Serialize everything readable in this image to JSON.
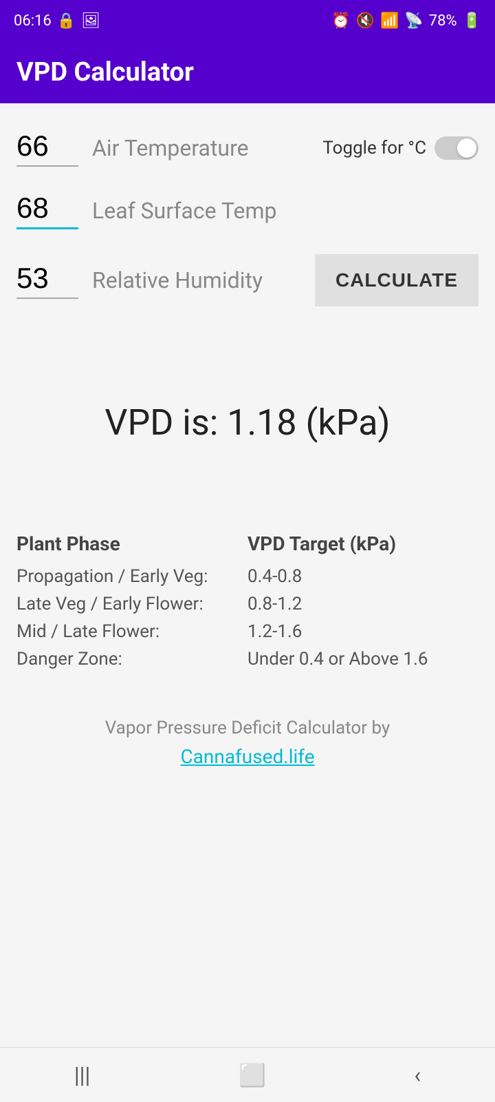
{
  "status_bar": {
    "time": "06:16",
    "battery": "78%"
  },
  "header": {
    "title": "VPD Calculator"
  },
  "fields": {
    "air_temp": {
      "label": "Air Temperature",
      "value": "66",
      "toggle_label": "Toggle for °C"
    },
    "leaf_surface_temp": {
      "label": "Leaf Surface Temp",
      "value": "68"
    },
    "relative_humidity": {
      "label": "Relative Humidity",
      "value": "53"
    }
  },
  "calculate_button": "CALCULATE",
  "vpd_result": "VPD is: 1.18 (kPa)",
  "reference_table": {
    "col1_header": "Plant Phase",
    "col2_header": "VPD Target (kPa)",
    "rows": [
      {
        "phase": "Propagation / Early Veg:",
        "target": "0.4-0.8"
      },
      {
        "phase": "Late Veg / Early Flower:",
        "target": "0.8-1.2"
      },
      {
        "phase": "Mid / Late Flower:",
        "target": "1.2-1.6"
      },
      {
        "phase": "Danger Zone:",
        "target": "Under 0.4 or Above 1.6"
      }
    ]
  },
  "footer": {
    "text": "Vapor Pressure Deficit Calculator by",
    "link": "Cannafused.life"
  }
}
